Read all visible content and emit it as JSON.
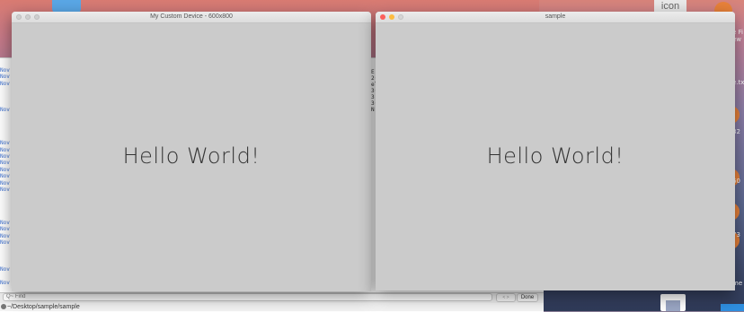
{
  "desktop": {
    "file_label": "icon",
    "right_strip": [
      "e Fi",
      "ew",
      "e.tx",
      "82",
      "60",
      "73",
      "me"
    ]
  },
  "editor": {
    "log_prefix": "Nov",
    "log_rows": [
      "Nov",
      "Nov",
      "Nov",
      "",
      "",
      "",
      "Nov",
      "",
      "",
      "",
      "",
      "Nov",
      "Nov",
      "Nov",
      "Nov",
      "Nov",
      "Nov",
      "Nov",
      "Nov",
      "",
      "",
      "",
      "",
      "Nov",
      "Nov",
      "Nov",
      "Nov",
      "",
      "",
      "",
      "Nov",
      "",
      "Nov",
      "",
      "Nov"
    ],
    "mid_rows": [
      "E",
      "2(",
      "el",
      "3(",
      "",
      "3!",
      "",
      "3(",
      "",
      "N"
    ],
    "find": {
      "placeholder": "Q~ Find",
      "nav_label": "< >",
      "done_label": "Done"
    },
    "path_text": "~/Desktop/sample/sample"
  },
  "window_left": {
    "title": "My Custom Device - 600x800",
    "content_text": "Hello World!"
  },
  "window_right": {
    "title": "sample",
    "content_text": "Hello World!"
  }
}
